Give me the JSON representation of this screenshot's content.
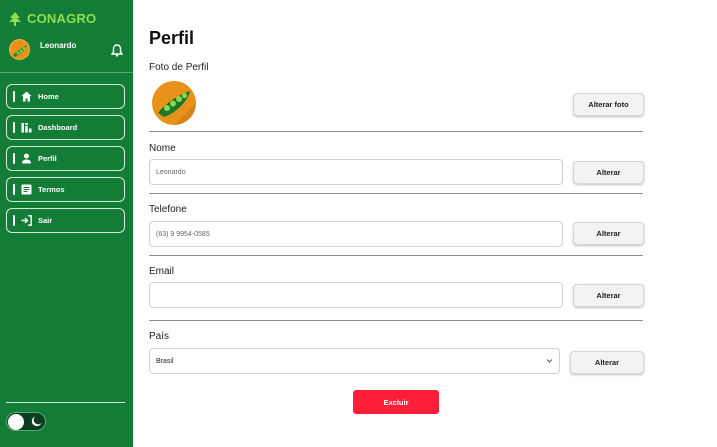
{
  "brand": {
    "name": "CONAGRO"
  },
  "user": {
    "name": "Leonardo"
  },
  "sidebar": {
    "items": [
      {
        "label": "Home",
        "icon": "home-icon"
      },
      {
        "label": "Dashboard",
        "icon": "dashboard-icon"
      },
      {
        "label": "Perfil",
        "icon": "person-icon"
      },
      {
        "label": "Termos",
        "icon": "document-icon"
      },
      {
        "label": "Sair",
        "icon": "logout-icon"
      }
    ]
  },
  "profile": {
    "title": "Perfil",
    "photo": {
      "label": "Foto de Perfil",
      "button": "Alterar foto"
    },
    "name": {
      "label": "Nome",
      "value": "Leonardo",
      "button": "Alterar"
    },
    "phone": {
      "label": "Telefone",
      "value": "(63) 9 9954-0585",
      "button": "Alterar"
    },
    "email": {
      "label": "Email",
      "value": "",
      "button": "Alterar"
    },
    "country": {
      "label": "País",
      "value": "Brasil",
      "button": "Alterar"
    },
    "delete_button": "Excluir"
  },
  "colors": {
    "sidebar": "#137d38",
    "brand_text": "#8ee04a",
    "danger": "#ff1e37",
    "avatar": "#e8921c"
  }
}
